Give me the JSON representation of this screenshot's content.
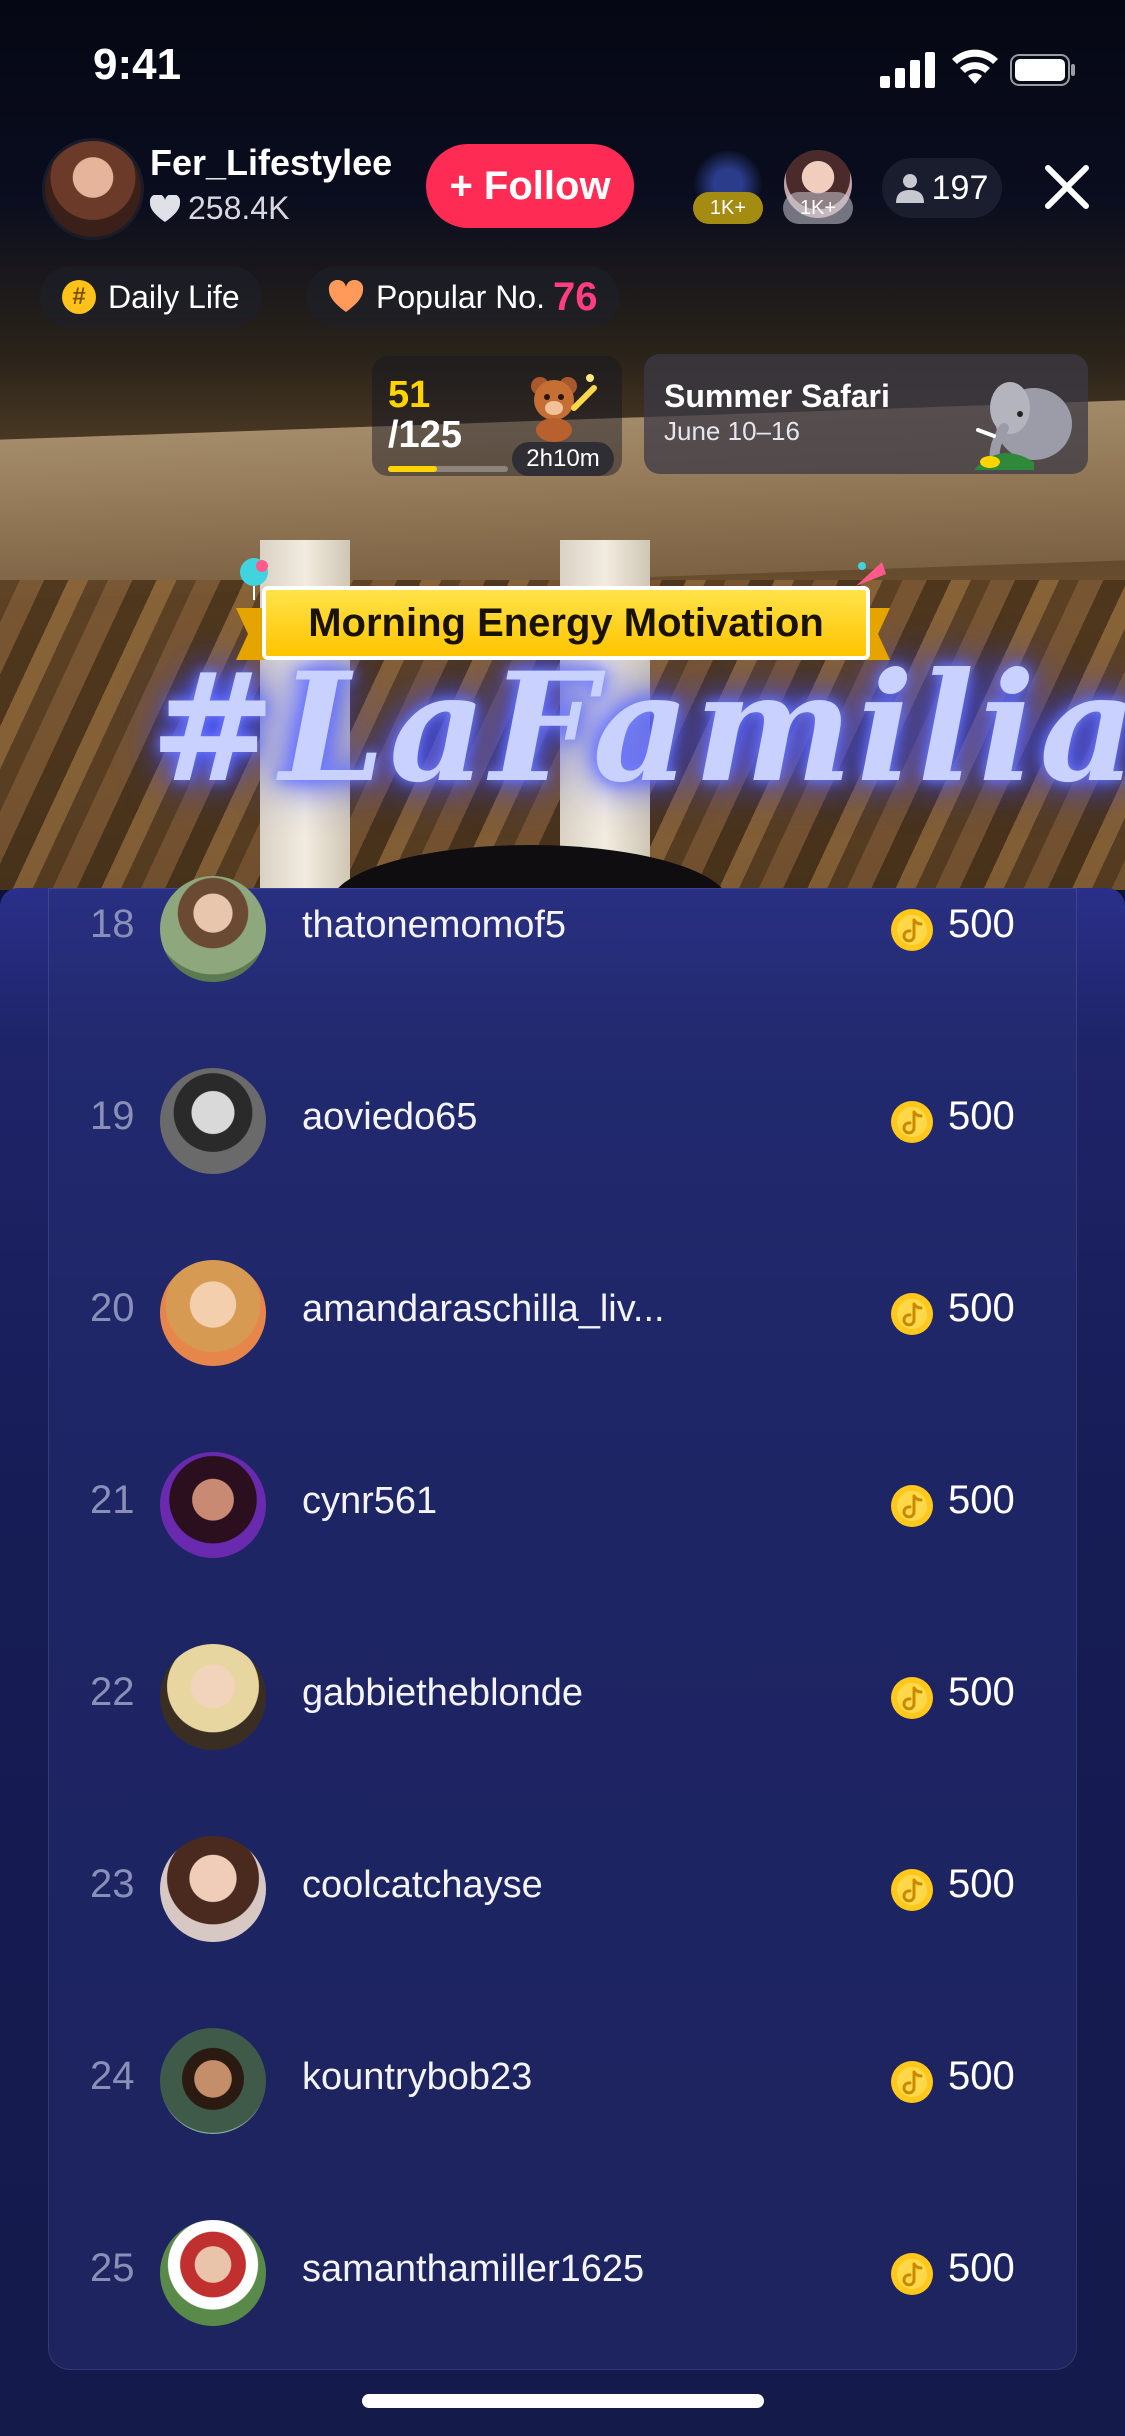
{
  "status_bar": {
    "time": "9:41"
  },
  "header": {
    "host_name": "Fer_Lifestylee",
    "host_likes": "258.4K",
    "follow_label": "+ Follow",
    "viewer_badges": [
      "1K+",
      "1K+"
    ],
    "viewer_count": "197"
  },
  "tags": {
    "category": "Daily Life",
    "popular_label": "Popular No.",
    "popular_rank": "76"
  },
  "goal": {
    "current": "51",
    "target": "/125",
    "progress": 0.408,
    "timer": "2h10m"
  },
  "event": {
    "title": "Summer Safari",
    "date": "June 10–16"
  },
  "banner": {
    "text": "Morning Energy Motivation"
  },
  "background": {
    "neon_text": "#LaFamilia"
  },
  "ranking": {
    "rows": [
      {
        "rank": "18",
        "username": "thatonemomof5",
        "coins": "500"
      },
      {
        "rank": "19",
        "username": "aoviedo65",
        "coins": "500"
      },
      {
        "rank": "20",
        "username": "amandaraschilla_liv...",
        "coins": "500"
      },
      {
        "rank": "21",
        "username": "cynr561",
        "coins": "500"
      },
      {
        "rank": "22",
        "username": "gabbietheblonde",
        "coins": "500"
      },
      {
        "rank": "23",
        "username": "coolcatchayse",
        "coins": "500"
      },
      {
        "rank": "24",
        "username": "kountrybob23",
        "coins": "500"
      },
      {
        "rank": "25",
        "username": "samanthamiller1625",
        "coins": "500"
      }
    ]
  },
  "colors": {
    "follow": "#fe2c55",
    "popular_rank": "#ff3d7f",
    "goal": "#ffd400",
    "coin": "#ffc81a",
    "panel": "#161c55"
  },
  "icons": [
    "heart-icon",
    "person-icon",
    "close-icon",
    "hashtag-icon",
    "orange-heart-icon",
    "teddy-bear-icon",
    "elephant-icon",
    "coin-icon"
  ]
}
